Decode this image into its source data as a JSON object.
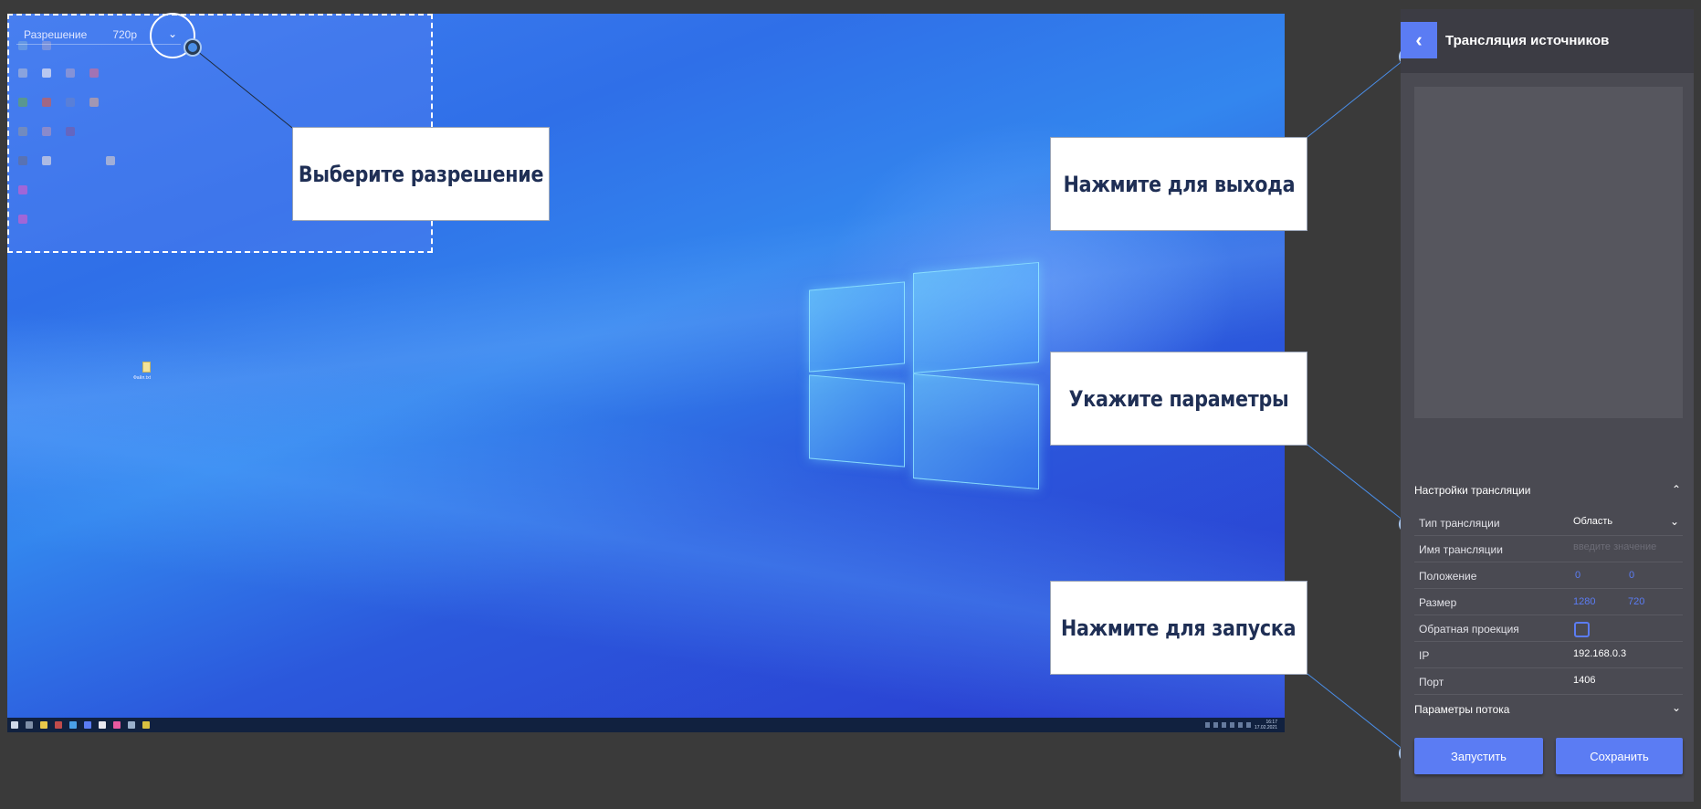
{
  "desktop": {
    "selection": {
      "resolution_label": "Разрешение",
      "resolution_value": "720p"
    },
    "file_label": "Файл.txt",
    "clock_time": "16:17",
    "clock_date": "17.02.2021"
  },
  "callouts": {
    "select_resolution": "Выберите разрешение",
    "press_to_exit": "Нажмите для выхода",
    "set_parameters": "Укажите параметры",
    "press_to_start": "Нажмите для запуска"
  },
  "panel": {
    "title": "Трансляция источников",
    "settings_section": "Настройки трансляции",
    "fields": {
      "type_label": "Тип трансляции",
      "type_value": "Область",
      "name_label": "Имя трансляции",
      "name_placeholder": "введите значение",
      "position_label": "Положение",
      "position_x": "0",
      "position_y": "0",
      "size_label": "Размер",
      "size_w": "1280",
      "size_h": "720",
      "reverse_label": "Обратная проекция",
      "ip_label": "IP",
      "ip_value": "192.168.0.3",
      "port_label": "Порт",
      "port_value": "1406"
    },
    "stream_section": "Параметры потока",
    "start_button": "Запустить",
    "save_button": "Сохранить"
  },
  "colors": {
    "accent": "#5b7cf3",
    "panel_bg": "#4a4a52",
    "page_bg": "#3a3a3a",
    "callout_text": "#1f2f55"
  }
}
